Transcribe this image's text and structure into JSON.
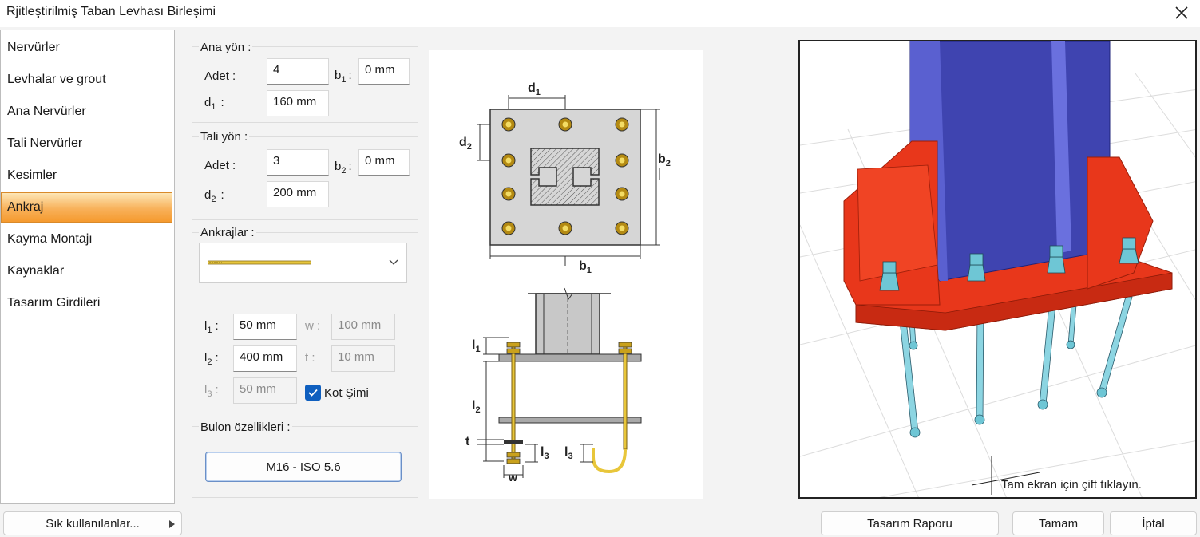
{
  "window": {
    "title": "Rjitleştirilmiş Taban Levhası Birleşimi",
    "close_icon": "close-icon"
  },
  "sidebar": {
    "items": [
      {
        "label": "Nervürler"
      },
      {
        "label": "Levhalar ve grout"
      },
      {
        "label": "Ana Nervürler"
      },
      {
        "label": "Tali Nervürler"
      },
      {
        "label": "Kesimler"
      },
      {
        "label": "Ankraj"
      },
      {
        "label": "Kayma Montajı"
      },
      {
        "label": "Kaynaklar"
      },
      {
        "label": "Tasarım Girdileri"
      }
    ],
    "selected": "Ankraj"
  },
  "ana_yon": {
    "title": "Ana yön :",
    "adet_label": "Adet :",
    "adet_value": "4",
    "b_main": "b",
    "b_sub": "1",
    "b_colon": ":",
    "b_value": "0 mm",
    "d_main": "d",
    "d_sub": "1",
    "d_colon": ":",
    "d_value": "160 mm"
  },
  "tali_yon": {
    "title": "Tali yön :",
    "adet_label": "Adet :",
    "adet_value": "3",
    "b_main": "b",
    "b_sub": "2",
    "b_colon": ":",
    "b_value": "0 mm",
    "d_main": "d",
    "d_sub": "2",
    "d_colon": ":",
    "d_value": "200 mm"
  },
  "ankrajlar": {
    "title": "Ankrajlar :",
    "selected_icon": "anchor-rod-icon",
    "l1_main": "l",
    "l1_sub": "1",
    "l1_colon": ":",
    "l1_value": "50 mm",
    "l2_main": "l",
    "l2_sub": "2",
    "l2_colon": ":",
    "l2_value": "400 mm",
    "l3_main": "l",
    "l3_sub": "3",
    "l3_colon": ":",
    "l3_value": "50 mm",
    "w_label": "w :",
    "w_value": "100 mm",
    "t_label": "t :",
    "t_value": "10 mm",
    "kot_label": "Kot Şimi",
    "kot_checked": true
  },
  "bulon": {
    "title": "Bulon özellikleri :",
    "button": "M16 - ISO 5.6"
  },
  "drawing": {
    "plan": {
      "d1": "d",
      "d1s": "1",
      "d2": "d",
      "d2s": "2",
      "b1": "b",
      "b1s": "1",
      "b2": "b",
      "b2s": "2"
    },
    "section": {
      "l1": "l",
      "l1s": "1",
      "l2": "l",
      "l2s": "2",
      "l3": "l",
      "l3s": "3",
      "l3b": "l",
      "l3bs": "3",
      "t": "t",
      "w": "w"
    }
  },
  "view3d": {
    "hint": "Tam ekran için çift tıklayın."
  },
  "footer": {
    "favorites": "Sık kullanılanlar...",
    "report": "Tasarım Raporu",
    "ok": "Tamam",
    "cancel": "İptal"
  },
  "colors": {
    "selected_item": "#f8b15a",
    "column": "#3f44b0",
    "plate": "#e8371b",
    "bolt": "#7fd6e0",
    "checkbox": "#0f5fbf"
  }
}
